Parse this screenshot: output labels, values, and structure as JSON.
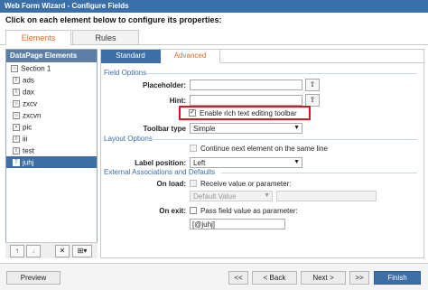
{
  "window": {
    "title": "Web Form Wizard - Configure Fields"
  },
  "instruction": "Click on each element below to configure its properties:",
  "top_tabs": [
    {
      "label": "Elements",
      "active": true
    },
    {
      "label": "Rules",
      "active": false
    }
  ],
  "left_panel": {
    "title": "DataPage Elements",
    "items": [
      {
        "label": "Section 1",
        "icon": "section-icon",
        "selected": false
      },
      {
        "label": "ads",
        "icon": "text-field-icon",
        "selected": false
      },
      {
        "label": "dax",
        "icon": "text-field-icon",
        "selected": false
      },
      {
        "label": "zxcv",
        "icon": "radio-icon",
        "selected": false
      },
      {
        "label": "zxcvn",
        "icon": "radio-icon",
        "selected": false
      },
      {
        "label": "pic",
        "icon": "picture-icon",
        "selected": false
      },
      {
        "label": "iii",
        "icon": "text-field-icon",
        "selected": false
      },
      {
        "label": "test",
        "icon": "text-field-icon",
        "selected": false
      },
      {
        "label": "juhj",
        "icon": "text-area-icon",
        "selected": true
      }
    ],
    "toolbar": {
      "up": "↑",
      "down": "↓",
      "delete": "✕",
      "add": "⊞▾"
    }
  },
  "right_tabs": [
    {
      "label": "Standard",
      "active": false
    },
    {
      "label": "Advanced",
      "active": true
    }
  ],
  "field_options": {
    "title": "Field Options",
    "placeholder_label": "Placeholder:",
    "placeholder_value": "",
    "hint_label": "Hint:",
    "hint_value": "",
    "rich_text_label": "Enable rich text editing toolbar",
    "rich_text_checked": true,
    "toolbar_type_label": "Toolbar type",
    "toolbar_type_value": "Simple"
  },
  "layout_options": {
    "title": "Layout Options",
    "continue_label": "Continue next element on the same line",
    "label_position_label": "Label position:",
    "label_position_value": "Left"
  },
  "external": {
    "title": "External Associations and Defaults",
    "on_load_label": "On load:",
    "receive_label": "Receive value or parameter:",
    "default_value_placeholder": "Default Value",
    "on_exit_label": "On exit:",
    "pass_label": "Pass field value as parameter:",
    "pass_value": "[@juhj]"
  },
  "footer": {
    "preview": "Preview",
    "back_first": "<<",
    "back": "< Back",
    "next": "Next >",
    "next_last": ">>",
    "finish": "Finish"
  },
  "colors": {
    "accent": "#3d6ea5",
    "active_tab": "#e06b1e",
    "highlight": "#e1141e"
  }
}
